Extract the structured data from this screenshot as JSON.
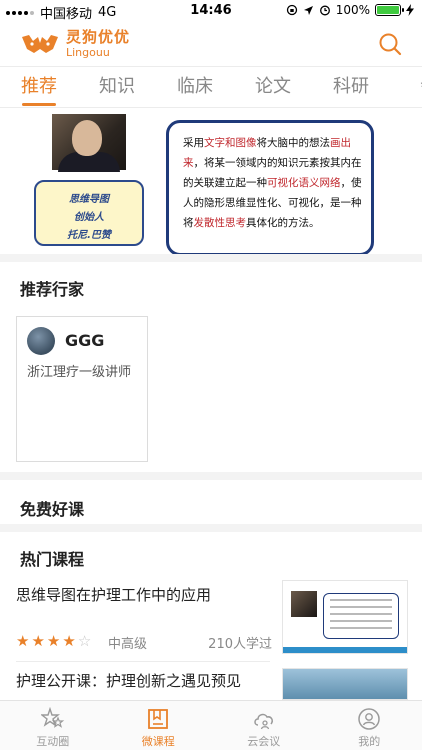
{
  "status_bar": {
    "carrier": "中国移动",
    "network": "4G",
    "time": "14:46",
    "battery": "100%",
    "battery_level": 1.0
  },
  "header": {
    "app_name_cn": "灵狗优优",
    "app_name_en": "Lingouu",
    "brand_color": "#e9812a"
  },
  "tabs": [
    {
      "label": "推荐",
      "active": true
    },
    {
      "label": "知识",
      "active": false
    },
    {
      "label": "临床",
      "active": false
    },
    {
      "label": "论文",
      "active": false
    },
    {
      "label": "科研",
      "active": false
    },
    {
      "label": "会",
      "active": false
    }
  ],
  "banner": {
    "scroll_line1": "思维导图",
    "scroll_line2": "创始人",
    "scroll_line3": "托尼.巴赞",
    "card_part1": "采用",
    "card_red1": "文字和图像",
    "card_part2": "将大脑中的想法",
    "card_red2": "画出来",
    "card_part3": "，将某一领域内的知识元素按其内在的关联建立起一种",
    "card_red3": "可视化语义网络",
    "card_part4": "，使人的隐形思维显性化、可视化，是一种将",
    "card_red4": "发散性思考",
    "card_part5": "具体化的方法。"
  },
  "experts_section": {
    "title": "推荐行家",
    "items": [
      {
        "name": "GGG",
        "title": "浙江理疗一级讲师"
      }
    ]
  },
  "free_courses_section": {
    "title": "免费好课"
  },
  "hot_courses_section": {
    "title": "热门课程",
    "courses": [
      {
        "title": "思维导图在护理工作中的应用",
        "rating": 4,
        "level": "中高级",
        "learners": "210人学过"
      },
      {
        "title": "护理公开课：护理创新之遇见预见"
      }
    ]
  },
  "bottom_nav": [
    {
      "label": "互动圈",
      "icon": "stars-icon",
      "active": false
    },
    {
      "label": "微课程",
      "icon": "bookmark-icon",
      "active": true
    },
    {
      "label": "云会议",
      "icon": "cloud-meeting-icon",
      "active": false
    },
    {
      "label": "我的",
      "icon": "profile-icon",
      "active": false
    }
  ]
}
